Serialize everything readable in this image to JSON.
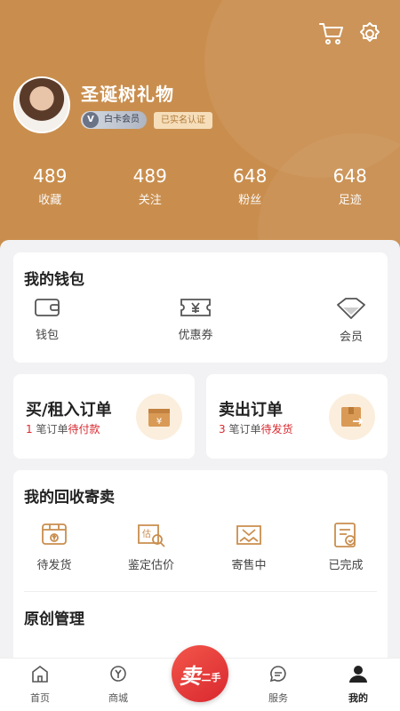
{
  "header": {
    "username": "圣诞树礼物",
    "member_badge": "白卡会员",
    "member_icon_letter": "V",
    "verified_badge": "已实名认证",
    "cart_icon": "cart-icon",
    "settings_icon": "gear-icon",
    "bg_color": "#c98e4e"
  },
  "stats": [
    {
      "value": "489",
      "label": "收藏"
    },
    {
      "value": "489",
      "label": "关注"
    },
    {
      "value": "648",
      "label": "粉丝"
    },
    {
      "value": "648",
      "label": "足迹"
    }
  ],
  "wallet": {
    "title": "我的钱包",
    "items": [
      {
        "label": "钱包",
        "icon": "wallet-icon"
      },
      {
        "label": "优惠券",
        "icon": "coupon-icon"
      },
      {
        "label": "会员",
        "icon": "diamond-icon"
      }
    ]
  },
  "orders": {
    "buy": {
      "title": "买/租入订单",
      "count": "1",
      "mid": " 笔订单",
      "status": "待付款",
      "icon": "box-yen-icon"
    },
    "sell": {
      "title": "卖出订单",
      "count": "3",
      "mid": " 笔订单",
      "status": "待发货",
      "icon": "box-out-icon"
    }
  },
  "recycle": {
    "title": "我的回收寄卖",
    "items": [
      {
        "label": "待发货",
        "icon": "ship-box-icon"
      },
      {
        "label": "鉴定估价",
        "icon": "appraise-icon"
      },
      {
        "label": "寄售中",
        "icon": "consign-icon"
      },
      {
        "label": "已完成",
        "icon": "done-doc-icon"
      }
    ]
  },
  "original": {
    "title": "原创管理"
  },
  "tabbar": {
    "tabs": [
      {
        "label": "首页",
        "icon": "home-icon"
      },
      {
        "label": "商城",
        "icon": "watch-icon"
      },
      {
        "label": "服务",
        "icon": "chat-icon"
      },
      {
        "label": "我的",
        "icon": "person-icon"
      }
    ],
    "sell_big": "卖",
    "sell_small": "二手",
    "accent": "#d9282f"
  }
}
